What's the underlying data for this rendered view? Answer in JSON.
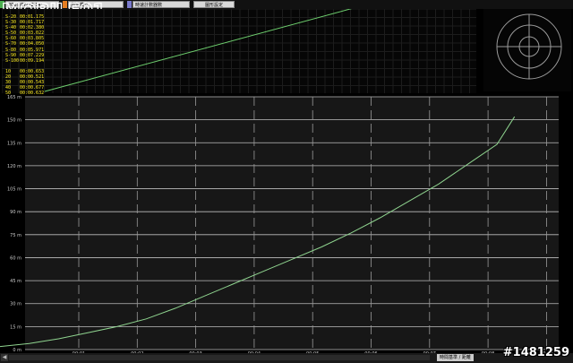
{
  "toolbar": {
    "item1": "2005/06/12 14:...",
    "item2": "測速模式",
    "item3": "時速計數器數",
    "button": "圖形設定",
    "swatch_colors": [
      "#4caf50",
      "#e67e22",
      "#7a7acc"
    ]
  },
  "logo": {
    "text": "MOBILE01"
  },
  "laps": [
    {
      "label": "S-20",
      "value": "00:01.175"
    },
    {
      "label": "S-30",
      "value": "00:01.717"
    },
    {
      "label": "S-40",
      "value": "00:02.380"
    },
    {
      "label": "S-50",
      "value": "00:03.022"
    },
    {
      "label": "S-60",
      "value": "00:03.805"
    },
    {
      "label": "S-70",
      "value": "00:04.050"
    },
    {
      "label": "S-80",
      "value": "00:05.971"
    },
    {
      "label": "S-90",
      "value": "00:07.229"
    },
    {
      "label": "S-100",
      "value": "00:09.194"
    },
    {
      "label": "",
      "value": ""
    },
    {
      "label": "10",
      "value": "00:00.653"
    },
    {
      "label": "20",
      "value": "00:00.521"
    },
    {
      "label": "30",
      "value": "00:00.543"
    },
    {
      "label": "40",
      "value": "00:00.677"
    },
    {
      "label": "50",
      "value": "00:00.632"
    }
  ],
  "chart_data": [
    {
      "type": "line",
      "title": "",
      "xlabel": "",
      "ylabel": "",
      "x_ticks": [
        "00:01",
        "00:02",
        "00:03",
        "00:04",
        "00:05",
        "00:06",
        "00:07",
        "00:08",
        "00:09"
      ],
      "y_ticks": [
        "0 m",
        "15 m",
        "30 m",
        "45 m",
        "60 m",
        "75 m",
        "90 m",
        "105 m",
        "120 m",
        "135 m",
        "150 m",
        "165 m"
      ],
      "ylim": [
        0,
        165
      ],
      "xlim": [
        0,
        9.3
      ],
      "grid": true,
      "line_color": "#8fd48f",
      "series": [
        {
          "x": [
            0.0,
            0.5,
            1.0,
            1.5,
            2.0,
            2.5,
            3.0,
            3.5,
            4.0,
            4.5,
            5.0,
            5.5,
            6.0,
            6.5,
            7.0,
            7.5,
            8.0,
            8.5,
            9.0,
            9.3
          ],
          "values": [
            0,
            2,
            4,
            7,
            11,
            15,
            20,
            27,
            35,
            43,
            51,
            59,
            67,
            76,
            86,
            97,
            108,
            121,
            134,
            152
          ]
        }
      ]
    },
    {
      "type": "line",
      "title": "",
      "xlabel": "",
      "ylabel": "",
      "grid": true,
      "ylim": [
        0,
        100
      ],
      "xlim": [
        0,
        9.3
      ],
      "line_color": "#6ecf6e",
      "series": [
        {
          "x": [
            0.0,
            9.3
          ],
          "values": [
            0,
            100
          ]
        }
      ]
    }
  ],
  "statusbar": {
    "label": "時間基準 / 距離"
  },
  "watermark": "#1481259"
}
